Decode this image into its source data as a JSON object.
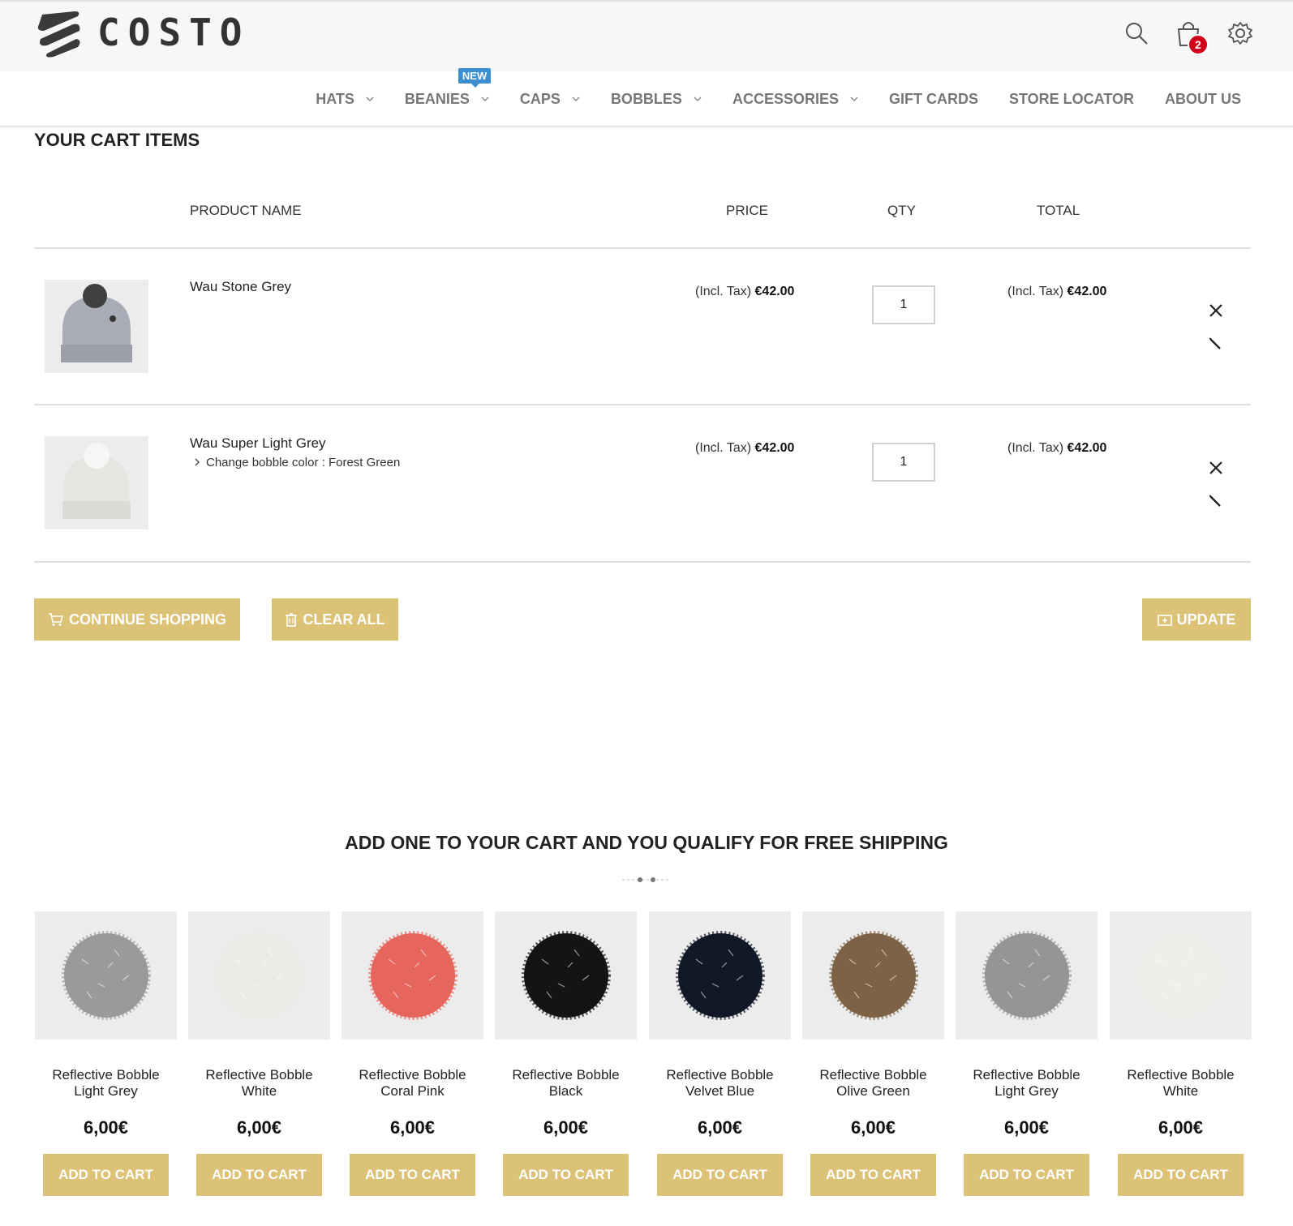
{
  "brand": {
    "name": "COSTO"
  },
  "header": {
    "cart_count": "2"
  },
  "nav": {
    "items": [
      {
        "label": "HATS",
        "dropdown": true
      },
      {
        "label": "BEANIES",
        "dropdown": true,
        "badge": "NEW"
      },
      {
        "label": "CAPS",
        "dropdown": true
      },
      {
        "label": "BOBBLES",
        "dropdown": true
      },
      {
        "label": "ACCESSORIES",
        "dropdown": true
      },
      {
        "label": "GIFT CARDS",
        "dropdown": false
      },
      {
        "label": "STORE LOCATOR",
        "dropdown": false
      },
      {
        "label": "ABOUT US",
        "dropdown": false
      }
    ]
  },
  "cart": {
    "title": "YOUR CART ITEMS",
    "columns": {
      "product": "PRODUCT NAME",
      "price": "PRICE",
      "qty": "QTY",
      "total": "TOTAL"
    },
    "tax_label": "(Incl. Tax)",
    "items": [
      {
        "name": "Wau Stone Grey",
        "option": "",
        "price": "€42.00",
        "qty": "1",
        "total": "€42.00",
        "color": "#a9abb6"
      },
      {
        "name": "Wau Super Light Grey",
        "option": "Change bobble color : Forest Green",
        "price": "€42.00",
        "qty": "1",
        "total": "€42.00",
        "color": "#e6e5e1"
      }
    ],
    "buttons": {
      "continue": "CONTINUE SHOPPING",
      "clear": "CLEAR ALL",
      "update": "UPDATE"
    }
  },
  "promo": {
    "title": "ADD ONE TO YOUR CART AND YOU QUALIFY FOR FREE SHIPPING",
    "button_label": "ADD TO CART",
    "products": [
      {
        "name_line1": "Reflective Bobble",
        "name_line2": "Light Grey",
        "price": "6,00€",
        "color": "#9a9a9a"
      },
      {
        "name_line1": "Reflective Bobble",
        "name_line2": "White",
        "price": "6,00€",
        "color": "#ecebe6"
      },
      {
        "name_line1": "Reflective Bobble",
        "name_line2": "Coral Pink",
        "price": "6,00€",
        "color": "#e6665e"
      },
      {
        "name_line1": "Reflective Bobble",
        "name_line2": "Black",
        "price": "6,00€",
        "color": "#141414"
      },
      {
        "name_line1": "Reflective Bobble",
        "name_line2": "Velvet Blue",
        "price": "6,00€",
        "color": "#111827"
      },
      {
        "name_line1": "Reflective Bobble",
        "name_line2": "Olive Green",
        "price": "6,00€",
        "color": "#7d6245"
      },
      {
        "name_line1": "Reflective Bobble",
        "name_line2": "Light Grey",
        "price": "6,00€",
        "color": "#959595"
      },
      {
        "name_line1": "Reflective Bobble",
        "name_line2": "White",
        "price": "6,00€",
        "color": "#efeee9"
      }
    ]
  },
  "colors": {
    "accent": "#dbc276",
    "badge": "#d0021b",
    "new_badge": "#3b8fd0"
  }
}
